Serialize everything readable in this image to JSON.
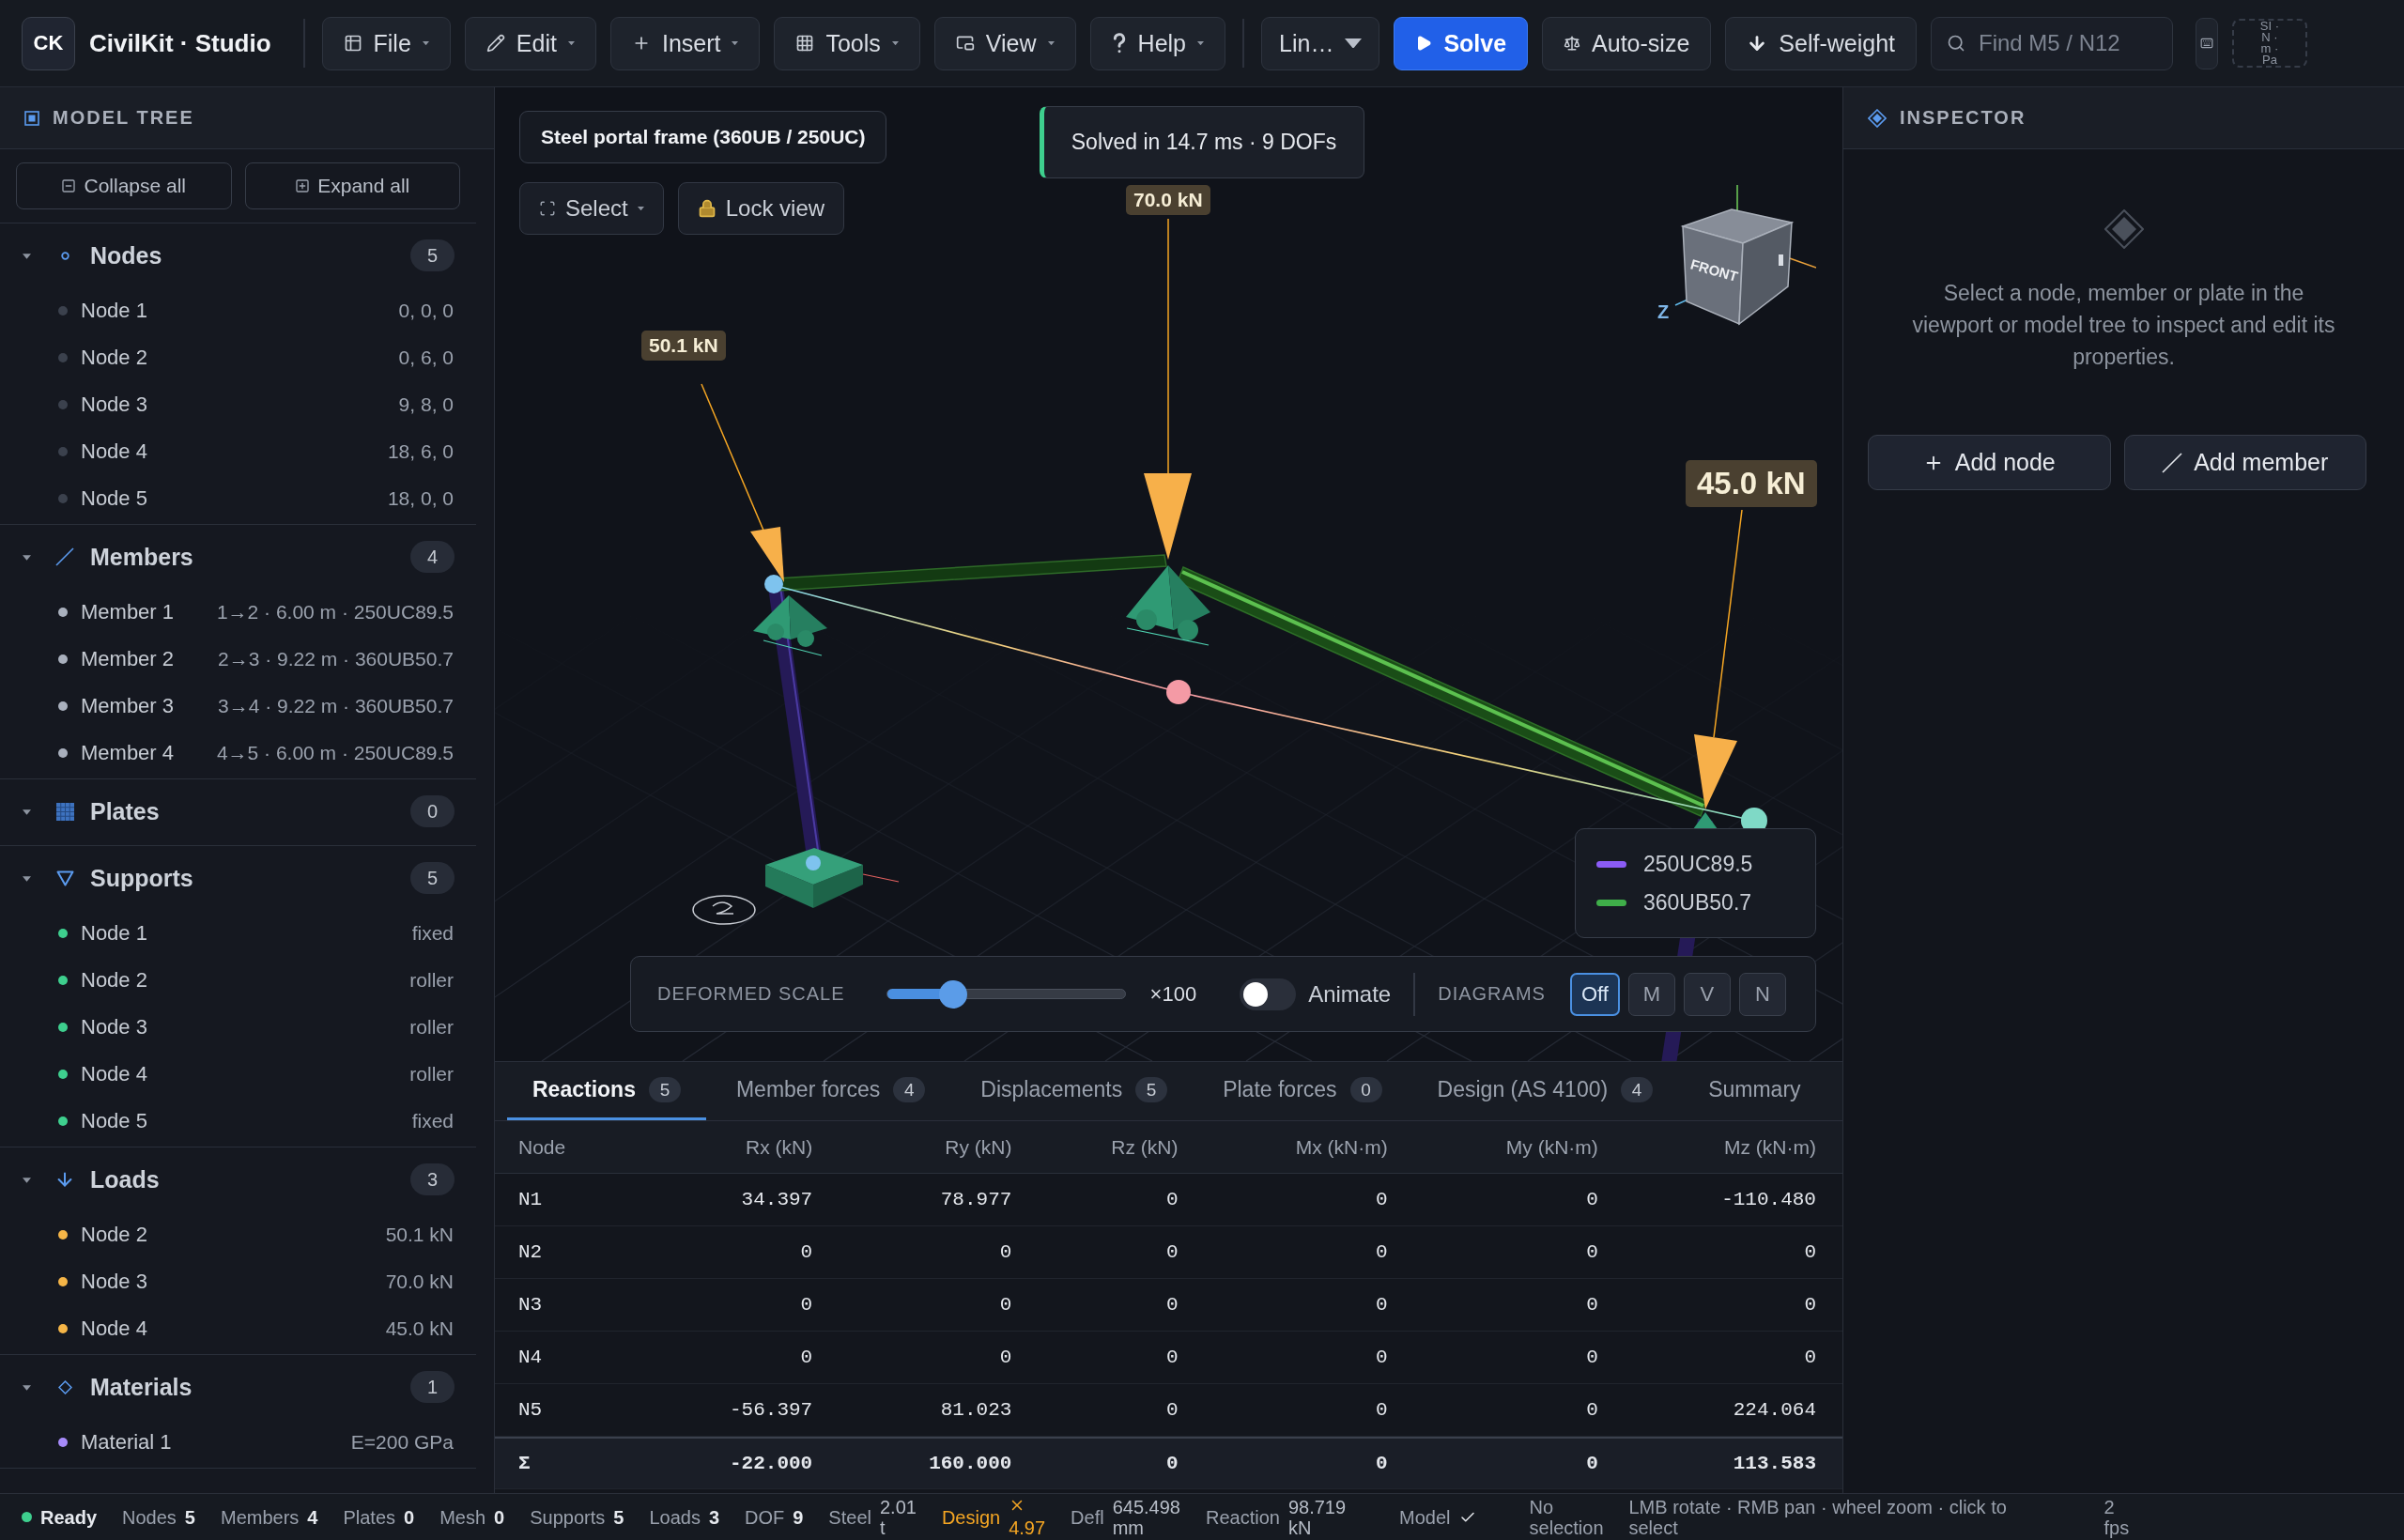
{
  "app": {
    "logo": "CK",
    "title": "CivilKit · Studio"
  },
  "menus": [
    {
      "label": "File"
    },
    {
      "label": "Edit"
    },
    {
      "label": "Insert"
    },
    {
      "label": "Tools"
    },
    {
      "label": "View"
    },
    {
      "label": "Help"
    }
  ],
  "toolbar": {
    "analysis": "Lin…",
    "solve": "Solve",
    "auto_size": "Auto-size",
    "self_weight": "Self-weight",
    "search": {
      "placeholder": "Find M5 / N12"
    },
    "units": "SI · N · m · Pa"
  },
  "model_tree": {
    "title": "MODEL TREE",
    "collapse_all": "Collapse all",
    "expand_all": "Expand all",
    "sections": [
      {
        "name": "Nodes",
        "count": "5",
        "expanded": true,
        "color": "#3b414d",
        "items": [
          {
            "name": "Node 1",
            "value": "0, 0, 0"
          },
          {
            "name": "Node 2",
            "value": "0, 6, 0"
          },
          {
            "name": "Node 3",
            "value": "9, 8, 0"
          },
          {
            "name": "Node 4",
            "value": "18, 6, 0"
          },
          {
            "name": "Node 5",
            "value": "18, 0, 0"
          }
        ]
      },
      {
        "name": "Members",
        "count": "4",
        "expanded": true,
        "color": "#a9b0bd",
        "items": [
          {
            "name": "Member 1",
            "value": "1→2 · 6.00 m · 250UC89.5"
          },
          {
            "name": "Member 2",
            "value": "2→3 · 9.22 m · 360UB50.7"
          },
          {
            "name": "Member 3",
            "value": "3→4 · 9.22 m · 360UB50.7"
          },
          {
            "name": "Member 4",
            "value": "4→5 · 6.00 m · 250UC89.5"
          }
        ]
      },
      {
        "name": "Plates",
        "count": "0",
        "expanded": true
      },
      {
        "name": "Supports",
        "count": "5",
        "expanded": true,
        "color": "#3ecf8e",
        "items": [
          {
            "name": "Node 1",
            "value": "fixed"
          },
          {
            "name": "Node 2",
            "value": "roller"
          },
          {
            "name": "Node 3",
            "value": "roller"
          },
          {
            "name": "Node 4",
            "value": "roller"
          },
          {
            "name": "Node 5",
            "value": "fixed"
          }
        ]
      },
      {
        "name": "Loads",
        "count": "3",
        "expanded": true,
        "color": "#f5b547",
        "items": [
          {
            "name": "Node 2",
            "value": "50.1 kN"
          },
          {
            "name": "Node 3",
            "value": "70.0 kN"
          },
          {
            "name": "Node 4",
            "value": "45.0 kN"
          }
        ]
      },
      {
        "name": "Materials",
        "count": "1",
        "expanded": true,
        "color": "#a78bfa",
        "items": [
          {
            "name": "Material 1",
            "value": "E=200 GPa"
          }
        ]
      }
    ]
  },
  "viewport": {
    "title": "Steel portal frame (360UB / 250UC)",
    "select": "Select",
    "lock_view": "Lock view",
    "toast": "Solved in 14.7 ms · 9 DOFs",
    "loads": [
      {
        "label": "50.1 kN",
        "highlighted": false
      },
      {
        "label": "70.0 kN",
        "highlighted": false
      },
      {
        "label": "45.0 kN",
        "highlighted": true
      }
    ],
    "viewcube": {
      "face": "FRONT",
      "axis": "Z"
    },
    "legend": [
      {
        "label": "250UC89.5",
        "color": "#8b5cf6"
      },
      {
        "label": "360UB50.7",
        "color": "#3fae49"
      }
    ],
    "deformed_scale": {
      "label": "DEFORMED SCALE",
      "level": 0.28,
      "reading": "×100"
    },
    "animate": {
      "label": "Animate",
      "on": false
    },
    "diagrams": {
      "label": "DIAGRAMS",
      "options": [
        {
          "label": "Off",
          "selected": true
        },
        {
          "label": "M",
          "selected": false
        },
        {
          "label": "V",
          "selected": false
        },
        {
          "label": "N",
          "selected": false
        }
      ]
    }
  },
  "results": {
    "tabs": [
      {
        "label": "Reactions",
        "count": "5",
        "selected": true
      },
      {
        "label": "Member forces",
        "count": "4",
        "selected": false
      },
      {
        "label": "Displacements",
        "count": "5",
        "selected": false
      },
      {
        "label": "Plate forces",
        "count": "0",
        "selected": false
      },
      {
        "label": "Design (AS 4100)",
        "count": "4",
        "selected": false
      },
      {
        "label": "Summary",
        "selected": false
      }
    ],
    "table": {
      "columns": [
        "Node",
        "Rx (kN)",
        "Ry (kN)",
        "Rz (kN)",
        "Mx (kN·m)",
        "My (kN·m)",
        "Mz (kN·m)"
      ],
      "rows": [
        [
          "N1",
          "34.397",
          "78.977",
          "0",
          "0",
          "0",
          "-110.480"
        ],
        [
          "N2",
          "0",
          "0",
          "0",
          "0",
          "0",
          "0"
        ],
        [
          "N3",
          "0",
          "0",
          "0",
          "0",
          "0",
          "0"
        ],
        [
          "N4",
          "0",
          "0",
          "0",
          "0",
          "0",
          "0"
        ],
        [
          "N5",
          "-56.397",
          "81.023",
          "0",
          "0",
          "0",
          "224.064"
        ]
      ],
      "total": [
        "Σ",
        "-22.000",
        "160.000",
        "0",
        "0",
        "0",
        "113.583"
      ]
    }
  },
  "inspector": {
    "title": "INSPECTOR",
    "empty_text": "Select a node, member or plate in the viewport or model tree to inspect and edit its properties.",
    "actions": [
      {
        "label": "Add node"
      },
      {
        "label": "Add member"
      }
    ]
  },
  "status_bar": {
    "state": {
      "label": "Ready",
      "busy": false
    },
    "counts": [
      {
        "label": "Nodes",
        "value": "5"
      },
      {
        "label": "Members",
        "value": "4"
      },
      {
        "label": "Plates",
        "value": "0"
      },
      {
        "label": "Mesh",
        "value": "0"
      },
      {
        "label": "Supports",
        "value": "5"
      },
      {
        "label": "Loads",
        "value": "3"
      },
      {
        "label": "DOF",
        "value": "9"
      }
    ],
    "steel": {
      "label": "Steel",
      "value": "2.01 t"
    },
    "design": {
      "label": "Design",
      "value": "4.97",
      "pass": false
    },
    "deflection": {
      "label": "Defl",
      "value": "645.498 mm"
    },
    "reaction": {
      "label": "Reaction",
      "value": "98.719 kN"
    },
    "model": {
      "label": "Model",
      "ok": true
    },
    "selection": "No selection",
    "hint": "LMB rotate · RMB pan · wheel zoom · click to select",
    "fps": "2 fps"
  }
}
